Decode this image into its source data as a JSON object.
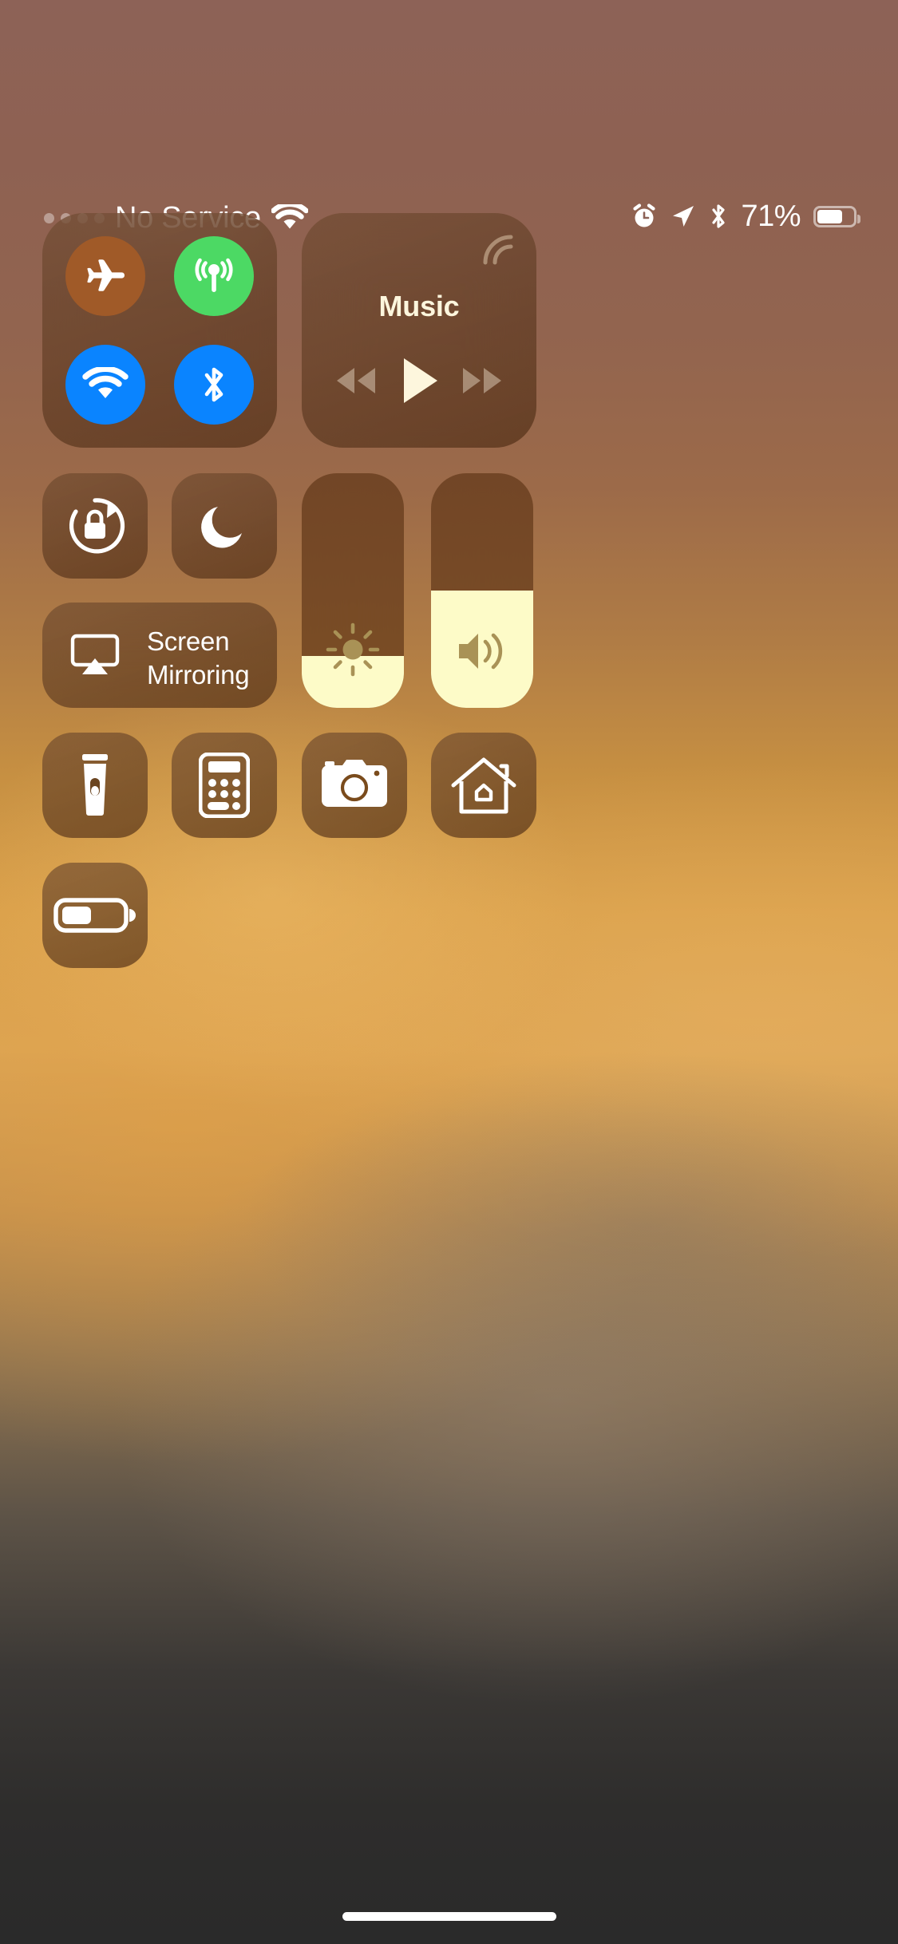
{
  "status_bar": {
    "signal_dots": 4,
    "carrier": "No Service",
    "wifi_icon": "wifi-icon",
    "alarm_icon": "alarm-clock-icon",
    "location_icon": "location-arrow-icon",
    "bluetooth_icon": "bluetooth-icon",
    "battery_percent": "71%",
    "battery_level": 71,
    "battery_icon": "battery-icon"
  },
  "connectivity": {
    "module_name": "connectivity-module",
    "toggles": [
      {
        "name": "airplane-mode-toggle",
        "icon": "airplane-icon",
        "state": "off",
        "color": "#a05a28"
      },
      {
        "name": "cellular-data-toggle",
        "icon": "cellular-antenna-icon",
        "state": "on",
        "color": "#4cd964"
      },
      {
        "name": "wifi-toggle",
        "icon": "wifi-icon",
        "state": "on",
        "color": "#0a84ff"
      },
      {
        "name": "bluetooth-toggle",
        "icon": "bluetooth-icon",
        "state": "on",
        "color": "#0a84ff"
      }
    ]
  },
  "music": {
    "module_name": "now-playing-module",
    "title": "Music",
    "airplay_icon": "airplay-routing-icon",
    "controls": [
      {
        "name": "rewind-button",
        "icon": "rewind-icon",
        "state": "dimmed"
      },
      {
        "name": "play-button",
        "icon": "play-icon",
        "state": "active"
      },
      {
        "name": "fast-forward-button",
        "icon": "fast-forward-icon",
        "state": "dimmed"
      }
    ]
  },
  "toggles_row": [
    {
      "name": "rotation-lock-toggle",
      "icon": "rotation-lock-icon",
      "state": "off",
      "label": ""
    },
    {
      "name": "do-not-disturb-toggle",
      "icon": "moon-icon",
      "state": "off",
      "label": ""
    }
  ],
  "screen_mirroring": {
    "name": "screen-mirroring-button",
    "icon": "airplay-screen-icon",
    "label_line1": "Screen",
    "label_line2": "Mirroring"
  },
  "sliders": [
    {
      "name": "brightness-slider",
      "icon": "brightness-sun-icon",
      "value": 22,
      "fill_color": "#fdfbc8"
    },
    {
      "name": "volume-slider",
      "icon": "volume-speaker-icon",
      "value": 50,
      "fill_color": "#fdfbc8"
    }
  ],
  "shortcuts": [
    {
      "name": "flashlight-button",
      "icon": "flashlight-icon"
    },
    {
      "name": "calculator-button",
      "icon": "calculator-icon"
    },
    {
      "name": "camera-button",
      "icon": "camera-icon"
    },
    {
      "name": "home-app-button",
      "icon": "home-house-icon"
    },
    {
      "name": "low-power-mode-button",
      "icon": "low-battery-icon"
    }
  ],
  "home_indicator": {
    "name": "home-indicator"
  },
  "colors": {
    "accent_blue": "#0a84ff",
    "accent_green": "#4cd964",
    "slider_fill": "#fdfbc8",
    "tile_tint": "rgba(92,52,22,0.62)",
    "text_primary": "#ffffff",
    "music_text": "#fdf6dd"
  }
}
